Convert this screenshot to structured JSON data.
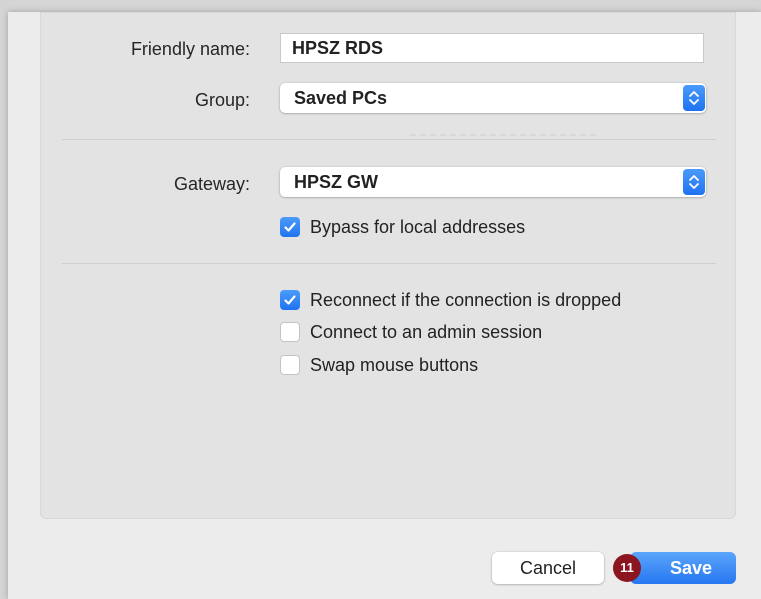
{
  "form": {
    "friendly_name_label": "Friendly name:",
    "friendly_name_value": "HPSZ RDS",
    "group_label": "Group:",
    "group_value": "Saved PCs",
    "gateway_label": "Gateway:",
    "gateway_value": "HPSZ GW"
  },
  "options": {
    "bypass_label": "Bypass for local addresses",
    "bypass_checked": true,
    "reconnect_label": "Reconnect if the connection is dropped",
    "reconnect_checked": true,
    "admin_label": "Connect to an admin session",
    "admin_checked": false,
    "swap_label": "Swap mouse buttons",
    "swap_checked": false
  },
  "footer": {
    "cancel_label": "Cancel",
    "save_label": "Save",
    "step_badge": "11"
  },
  "colors": {
    "accent": "#1f72f0",
    "badge": "#8b1620"
  },
  "icons": {
    "popup": "chevron-up-down-icon",
    "check": "checkmark-icon"
  }
}
